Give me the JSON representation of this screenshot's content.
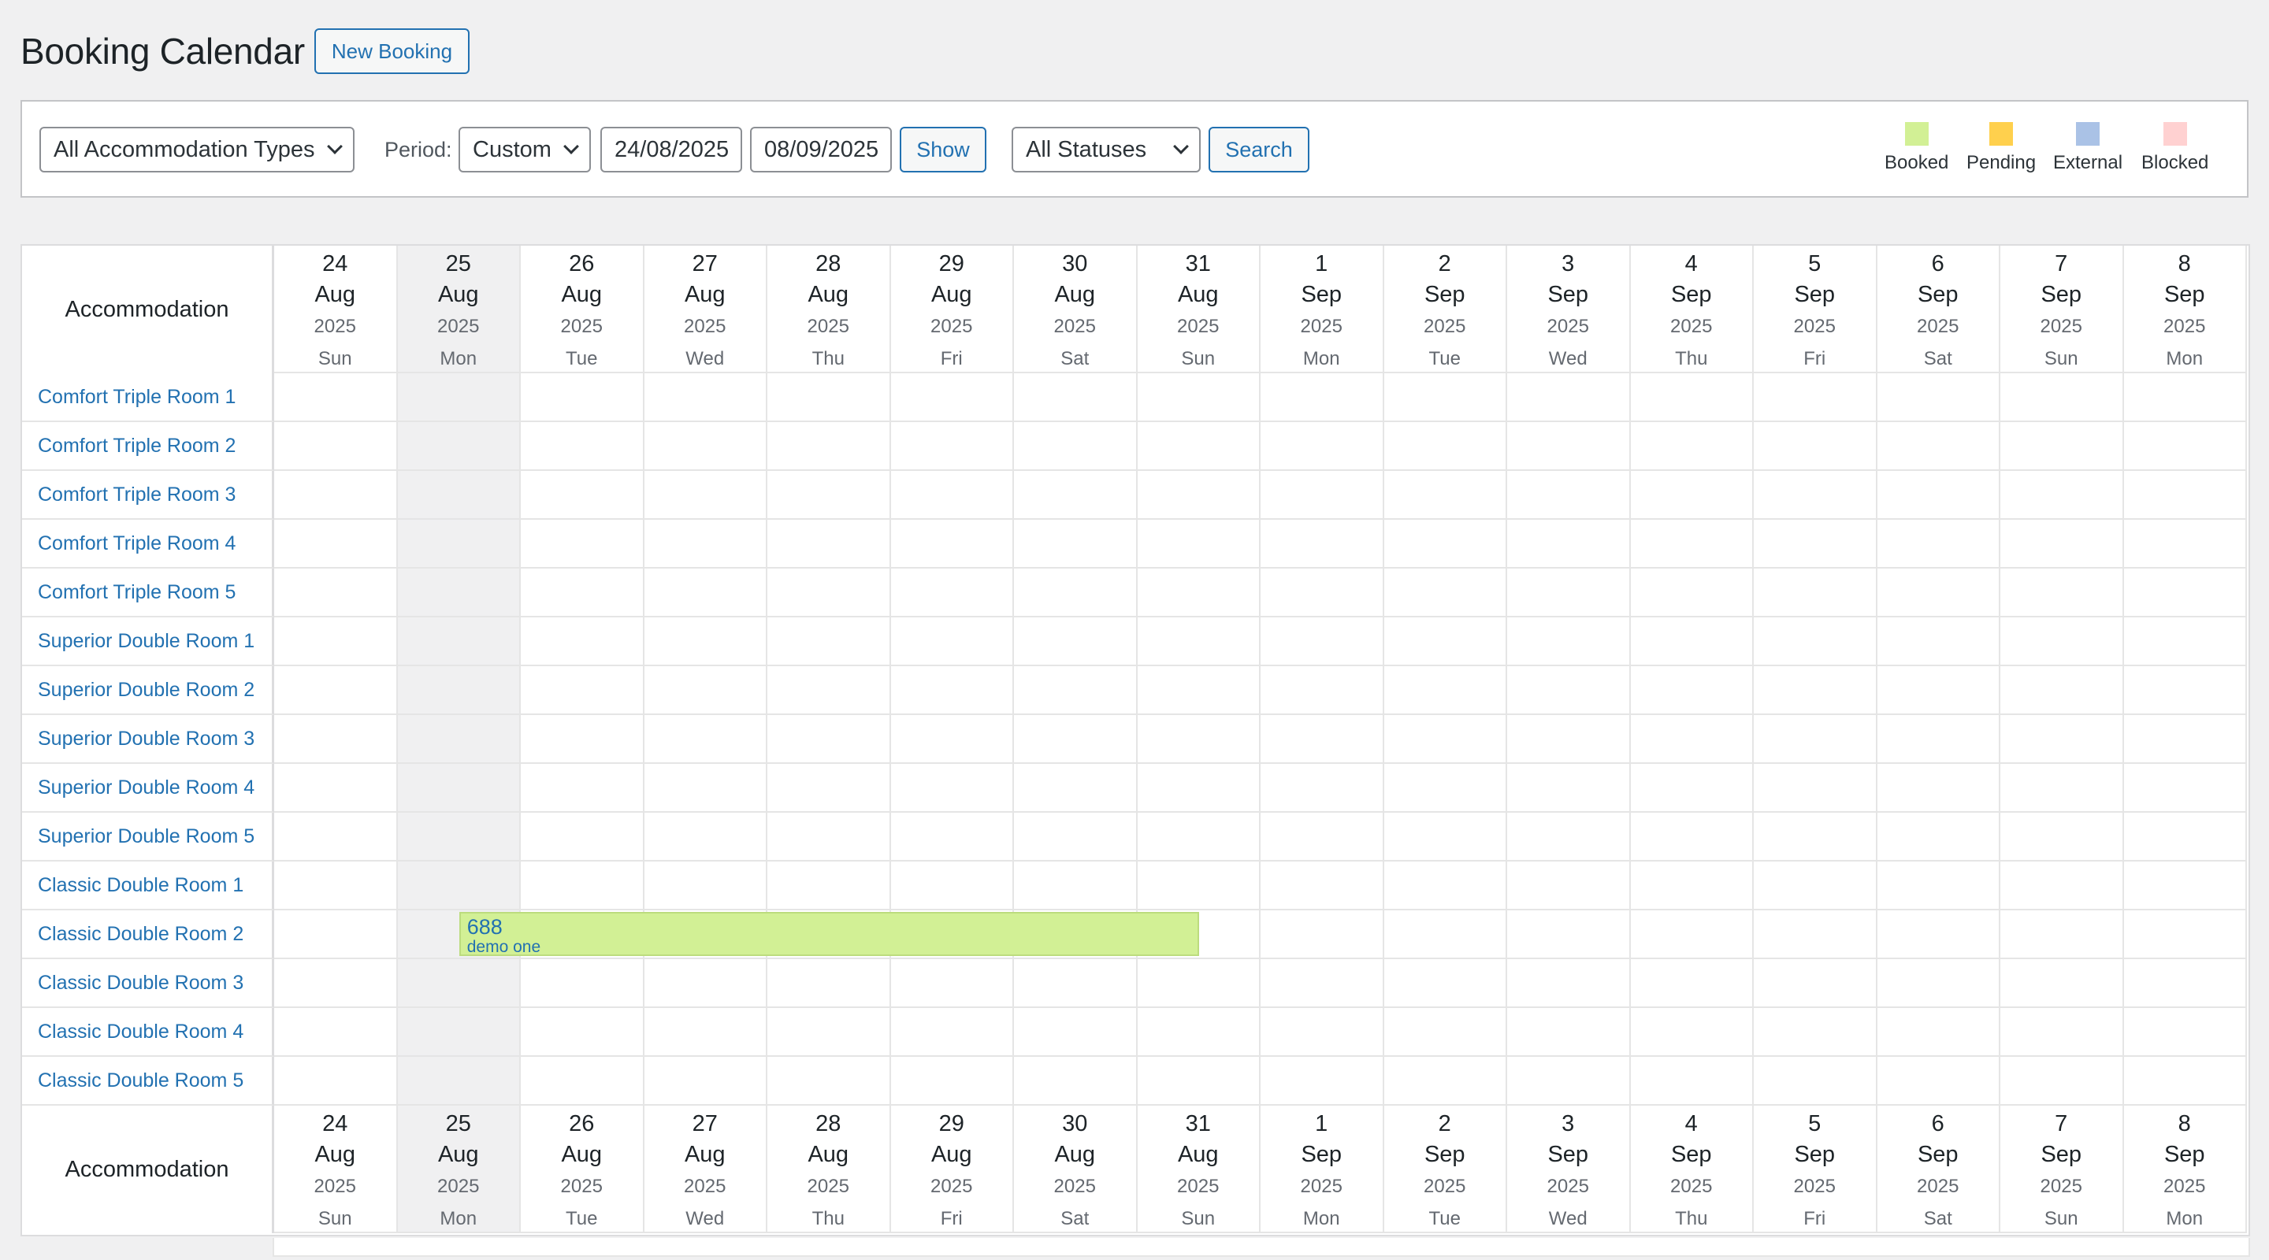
{
  "header": {
    "title": "Booking Calendar",
    "new_booking_label": "New Booking"
  },
  "filters": {
    "accommodation_type": "All Accommodation Types",
    "period_label": "Period:",
    "period_value": "Custom",
    "date_from": "24/08/2025",
    "date_to": "08/09/2025",
    "show_label": "Show",
    "status": "All Statuses",
    "search_label": "Search"
  },
  "legend": [
    {
      "label": "Booked",
      "color": "#d2f095"
    },
    {
      "label": "Pending",
      "color": "#ffd04d"
    },
    {
      "label": "External",
      "color": "#aac2e6"
    },
    {
      "label": "Blocked",
      "color": "#ffd1d1"
    }
  ],
  "table": {
    "accommodation_header": "Accommodation",
    "days": [
      {
        "day": "24",
        "month": "Aug",
        "year": "2025",
        "weekday": "Sun"
      },
      {
        "day": "25",
        "month": "Aug",
        "year": "2025",
        "weekday": "Mon"
      },
      {
        "day": "26",
        "month": "Aug",
        "year": "2025",
        "weekday": "Tue"
      },
      {
        "day": "27",
        "month": "Aug",
        "year": "2025",
        "weekday": "Wed"
      },
      {
        "day": "28",
        "month": "Aug",
        "year": "2025",
        "weekday": "Thu"
      },
      {
        "day": "29",
        "month": "Aug",
        "year": "2025",
        "weekday": "Fri"
      },
      {
        "day": "30",
        "month": "Aug",
        "year": "2025",
        "weekday": "Sat"
      },
      {
        "day": "31",
        "month": "Aug",
        "year": "2025",
        "weekday": "Sun"
      },
      {
        "day": "1",
        "month": "Sep",
        "year": "2025",
        "weekday": "Mon"
      },
      {
        "day": "2",
        "month": "Sep",
        "year": "2025",
        "weekday": "Tue"
      },
      {
        "day": "3",
        "month": "Sep",
        "year": "2025",
        "weekday": "Wed"
      },
      {
        "day": "4",
        "month": "Sep",
        "year": "2025",
        "weekday": "Thu"
      },
      {
        "day": "5",
        "month": "Sep",
        "year": "2025",
        "weekday": "Fri"
      },
      {
        "day": "6",
        "month": "Sep",
        "year": "2025",
        "weekday": "Sat"
      },
      {
        "day": "7",
        "month": "Sep",
        "year": "2025",
        "weekday": "Sun"
      },
      {
        "day": "8",
        "month": "Sep",
        "year": "2025",
        "weekday": "Mon"
      }
    ],
    "highlighted_day_index": 1,
    "rooms": [
      "Comfort Triple Room 1",
      "Comfort Triple Room 2",
      "Comfort Triple Room 3",
      "Comfort Triple Room 4",
      "Comfort Triple Room 5",
      "Superior Double Room 1",
      "Superior Double Room 2",
      "Superior Double Room 3",
      "Superior Double Room 4",
      "Superior Double Room 5",
      "Classic Double Room 1",
      "Classic Double Room 2",
      "Classic Double Room 3",
      "Classic Double Room 4",
      "Classic Double Room 5"
    ],
    "bookings": [
      {
        "room_index": 11,
        "start_day_index": 1,
        "end_day_index": 7,
        "id": "688",
        "guest": "demo one",
        "status": "Booked"
      }
    ]
  }
}
